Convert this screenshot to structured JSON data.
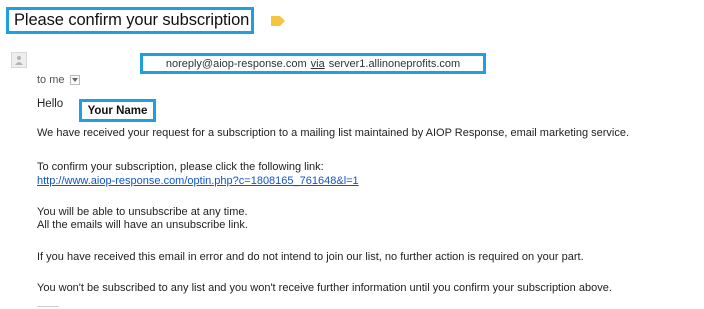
{
  "email": {
    "subject": "Please confirm your subscription",
    "sender": {
      "from": "noreply@aiop-response.com",
      "via_label": "via",
      "via_server": "server1.allinoneprofits.com"
    },
    "to_label": "to me",
    "greeting": "Hello",
    "recipient_name": "Your Name",
    "body": {
      "p1": "We have received your request for a subscription to a mailing list maintained by AIOP Response, email marketing service.",
      "p2_intro": "To confirm your subscription, please click the following link:",
      "confirm_link": "http://www.aiop-response.com/optin.php?c=1808165_761648&l=1",
      "p3_line1": "You will be able to unsubscribe at any time.",
      "p3_line2": "All the emails will have an unsubscribe link.",
      "p4": "If you have received this email in error and do not intend to join our list, no further action is required on your part.",
      "p5": "You won't be subscribed to any list and you won't receive further information until you confirm your subscription above."
    }
  },
  "colors": {
    "highlight_border": "#1e9fe0",
    "label_tag": "#f5c542",
    "link": "#1155cc"
  },
  "icons": {
    "label": "label-tag-icon",
    "avatar": "person-icon",
    "details": "chevron-down-icon"
  }
}
